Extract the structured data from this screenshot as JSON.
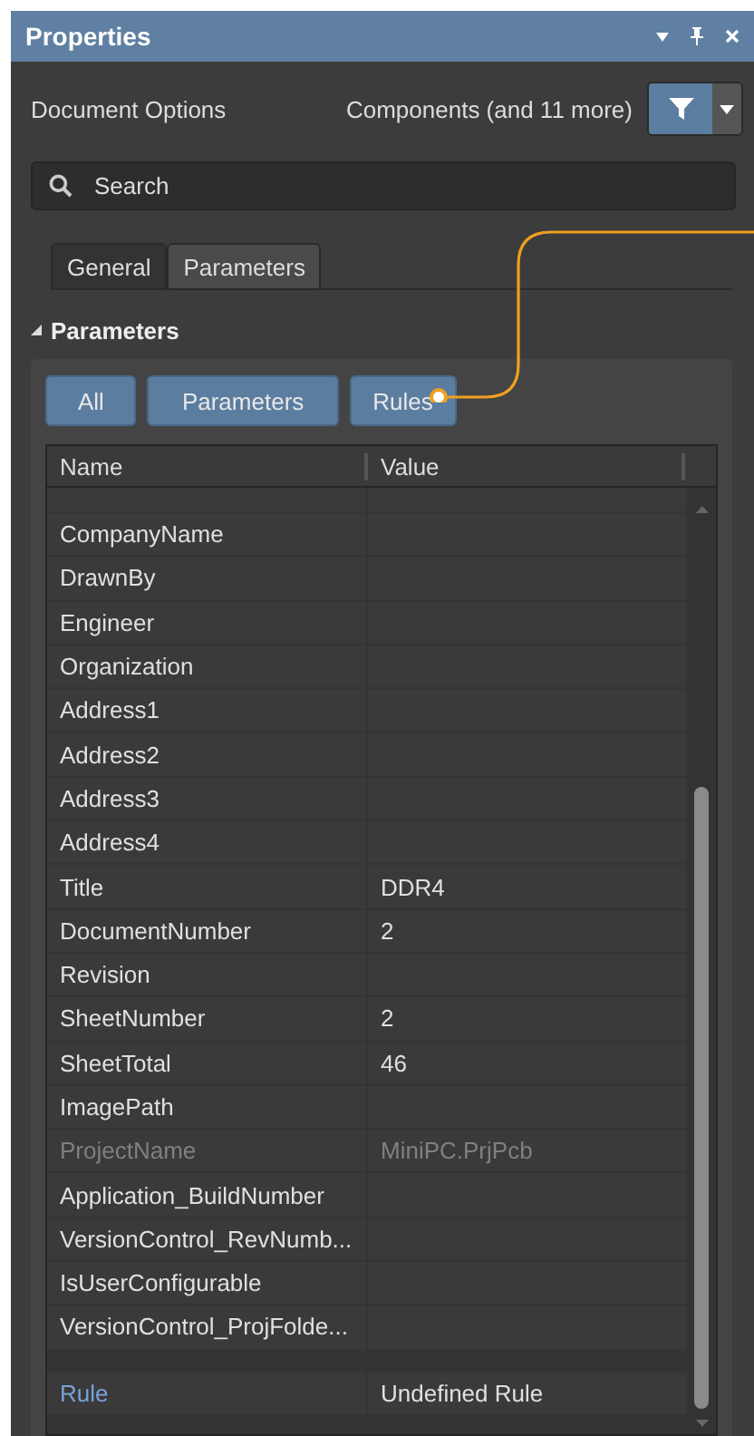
{
  "panel": {
    "title": "Properties"
  },
  "header": {
    "label": "Document Options",
    "filter_text": "Components (and 11 more)"
  },
  "search": {
    "placeholder": "Search"
  },
  "tabs": [
    {
      "label": "General",
      "selected": false
    },
    {
      "label": "Parameters",
      "selected": true
    }
  ],
  "section": {
    "title": "Parameters",
    "expanded": true
  },
  "filter_buttons": [
    "All",
    "Parameters",
    "Rules"
  ],
  "table": {
    "columns": [
      "Name",
      "Value"
    ],
    "rows": [
      {
        "kind": "parameter",
        "name": "CompanyName",
        "disabled": false
      },
      {
        "kind": "parameter",
        "name": "DrawnBy",
        "disabled": false
      },
      {
        "kind": "parameter",
        "name": "Engineer",
        "disabled": false
      },
      {
        "kind": "parameter",
        "name": "Organization",
        "disabled": false
      },
      {
        "kind": "parameter",
        "name": "Address1",
        "disabled": false
      },
      {
        "kind": "parameter",
        "name": "Address2",
        "disabled": false
      },
      {
        "kind": "parameter",
        "name": "Address3",
        "disabled": false
      },
      {
        "kind": "parameter",
        "name": "Address4",
        "disabled": false
      },
      {
        "kind": "parameter",
        "name": "Title",
        "value": "DDR4",
        "disabled": false
      },
      {
        "kind": "parameter",
        "name": "DocumentNumber",
        "value": "2",
        "disabled": false
      },
      {
        "kind": "parameter",
        "name": "Revision",
        "disabled": false
      },
      {
        "kind": "parameter",
        "name": "SheetNumber",
        "value": "2",
        "disabled": false
      },
      {
        "kind": "parameter",
        "name": "SheetTotal",
        "value": "46",
        "disabled": false
      },
      {
        "kind": "parameter",
        "name": "ImagePath",
        "disabled": false
      },
      {
        "kind": "parameter",
        "name": "ProjectName",
        "value": "MiniPC.PrjPcb",
        "disabled": true
      },
      {
        "kind": "parameter",
        "name": "Application_BuildNumber",
        "disabled": false
      },
      {
        "kind": "parameter",
        "name": "VersionControl_RevNumb...",
        "disabled": false
      },
      {
        "kind": "parameter",
        "name": "IsUserConfigurable",
        "disabled": false
      },
      {
        "kind": "parameter",
        "name": "VersionControl_ProjFolde...",
        "disabled": false
      },
      {
        "kind": "rule",
        "name": "Rule",
        "value": "Undefined Rule",
        "disabled": false
      }
    ]
  }
}
